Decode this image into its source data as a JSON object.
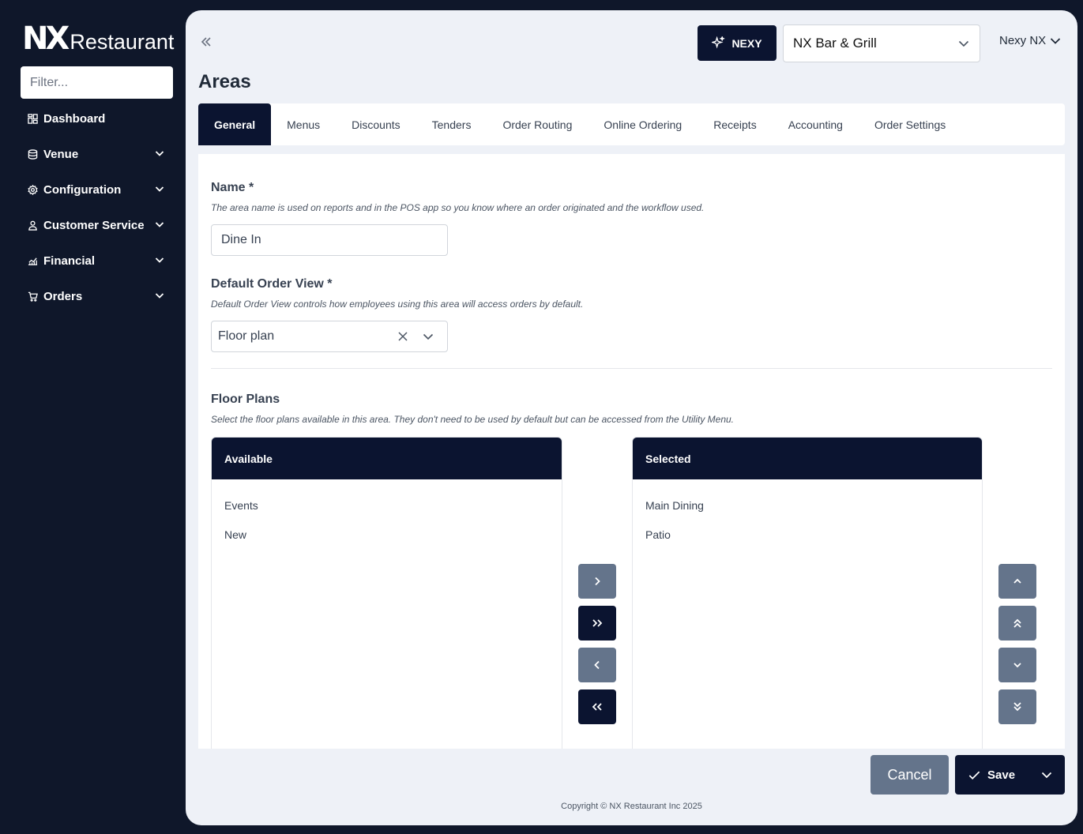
{
  "brand": {
    "mark": "NX",
    "name": "Restaurant"
  },
  "sidebar": {
    "filter_placeholder": "Filter...",
    "items": [
      {
        "label": "Dashboard",
        "icon": "dashboard-icon"
      },
      {
        "label": "Venue",
        "icon": "database-icon"
      },
      {
        "label": "Configuration",
        "icon": "gear-icon"
      },
      {
        "label": "Customer Service",
        "icon": "user-icon"
      },
      {
        "label": "Financial",
        "icon": "chart-icon"
      },
      {
        "label": "Orders",
        "icon": "cart-icon"
      }
    ]
  },
  "header": {
    "nexy_label": "NEXY",
    "venue": "NX Bar & Grill",
    "user": "Nexy NX"
  },
  "page": {
    "title": "Areas"
  },
  "tabs": [
    {
      "label": "General",
      "active": true
    },
    {
      "label": "Menus"
    },
    {
      "label": "Discounts"
    },
    {
      "label": "Tenders"
    },
    {
      "label": "Order Routing"
    },
    {
      "label": "Online Ordering"
    },
    {
      "label": "Receipts"
    },
    {
      "label": "Accounting"
    },
    {
      "label": "Order Settings"
    }
  ],
  "form": {
    "name": {
      "label": "Name *",
      "help": "The area name is used on reports and in the POS app so you know where an order originated and the workflow used.",
      "value": "Dine In"
    },
    "default_order_view": {
      "label": "Default Order View *",
      "help": "Default Order View controls how employees using this area will access orders by default.",
      "value": "Floor plan"
    },
    "floor_plans": {
      "label": "Floor Plans",
      "help": "Select the floor plans available in this area. They don't need to be used by default but can be accessed from the Utility Menu.",
      "available_header": "Available",
      "available": [
        "Events",
        "New"
      ],
      "selected_header": "Selected",
      "selected": [
        "Main Dining",
        "Patio"
      ]
    }
  },
  "actions": {
    "cancel": "Cancel",
    "save": "Save"
  },
  "footer": {
    "copyright": "Copyright © NX Restaurant Inc 2025"
  },
  "colors": {
    "navy": "#0b1430",
    "sidebar_bg": "#0f172a",
    "gray_button": "#64748b"
  }
}
